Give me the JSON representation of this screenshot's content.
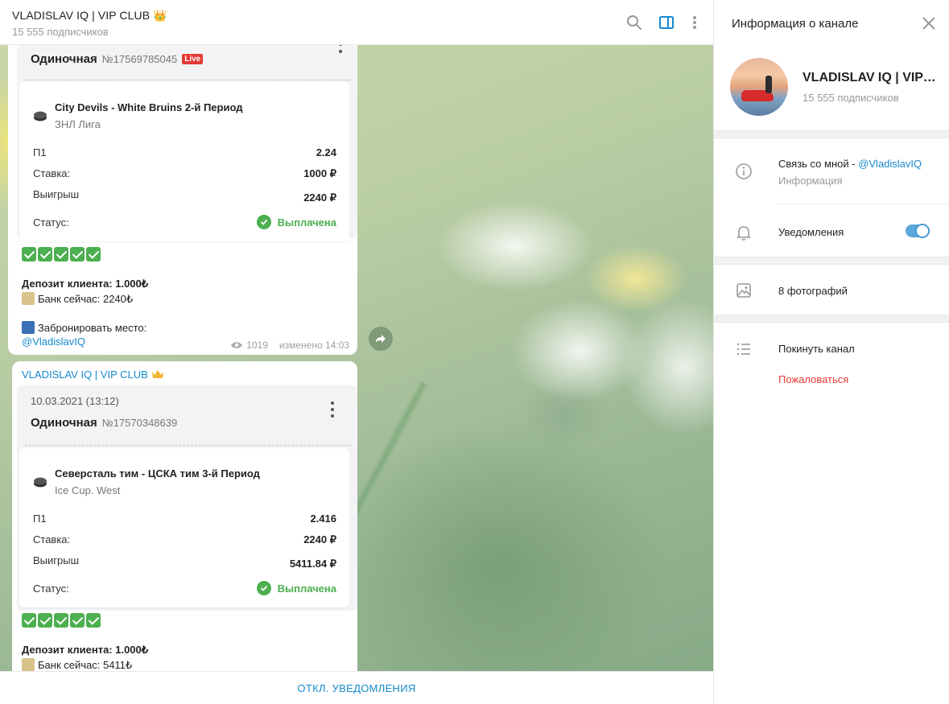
{
  "header": {
    "title": "VLADISLAV IQ | VIP CLUB 👑",
    "subscribers": "15 555 подписчиков"
  },
  "messages": [
    {
      "date": "",
      "bet_type": "Одиночная",
      "bet_number": "№17569785045",
      "live_badge": "Live",
      "event": "City Devils - White Bruins 2-й Период",
      "league": "ЗНЛ Лига",
      "rows": [
        {
          "label": "П1",
          "value": "2.24"
        },
        {
          "label": "Ставка:",
          "value": "1000 ₽"
        },
        {
          "label": "Выигрыш",
          "value": "2240 ₽"
        }
      ],
      "status_label": "Статус:",
      "status_value": "Выплачена",
      "deposit": "Депозит клиента: 1.000₺",
      "bank": "Банк сейчас: 2240₺",
      "book_label": "Забронировать место:",
      "book_link": "@VladislavIQ",
      "views": "1019",
      "edited": "изменено 14:03"
    },
    {
      "sender": "VLADISLAV IQ | VIP CLUB",
      "date": "10.03.2021 (13:12)",
      "bet_type": "Одиночная",
      "bet_number": "№17570348639",
      "event": "Северсталь тим - ЦСКА тим 3-й Период",
      "league": "Ice Cup. West",
      "rows": [
        {
          "label": "П1",
          "value": "2.416"
        },
        {
          "label": "Ставка:",
          "value": "2240 ₽"
        },
        {
          "label": "Выигрыш",
          "value": "5411.84 ₽"
        }
      ],
      "status_label": "Статус:",
      "status_value": "Выплачена",
      "deposit": "Депозит клиента: 1.000₺",
      "bank": "Банк сейчас: 5411₺"
    }
  ],
  "bottom": {
    "mute_label": "ОТКЛ. УВЕДОМЛЕНИЯ"
  },
  "panel": {
    "title": "Информация о канале",
    "channel_name": "VLADISLAV IQ | VIP CLUB",
    "channel_subs": "15 555 подписчиков",
    "contact_text": "Связь со мной - ",
    "contact_link": "@VladislavIQ",
    "info_label": "Информация",
    "notifications_label": "Уведомления",
    "notifications_on": true,
    "photos_label": "8 фотографий",
    "leave_label": "Покинуть канал",
    "report_label": "Пожаловаться"
  },
  "colors": {
    "accent": "#168acd",
    "success": "#4caf50",
    "danger": "#e53935",
    "toggle": "#5ba6db"
  }
}
